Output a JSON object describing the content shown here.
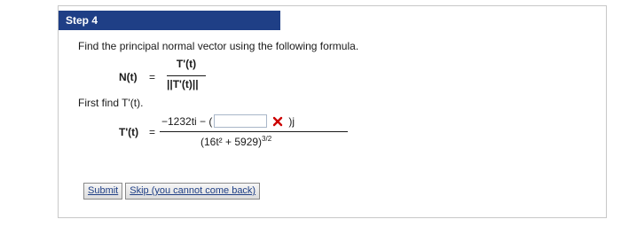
{
  "step": {
    "label": "Step 4"
  },
  "instruction": "Find the principal normal vector using the following formula.",
  "formula_normal": {
    "lhs": "N(t)",
    "equals": "=",
    "numerator": "T'(t)",
    "denominator": "||T'(t)||"
  },
  "first_find": "First find T'(t).",
  "formula_tprime": {
    "lhs": "T'(t)",
    "equals": "=",
    "numerator_prefix": "−1232ti − (",
    "input_value": "",
    "numerator_suffix": ")j",
    "denominator_base": "(16t² + 5929)",
    "denominator_exp": "3/2"
  },
  "status": {
    "icon": "incorrect-x-icon",
    "color": "#cc0000"
  },
  "buttons": {
    "submit": "Submit",
    "skip": "Skip (you cannot come back)"
  }
}
